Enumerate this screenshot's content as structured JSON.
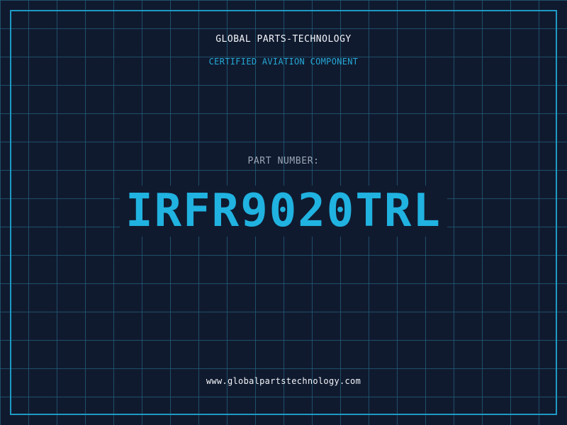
{
  "brand": {
    "name": "GLOBAL PARTS-TECHNOLOGY",
    "tagline": "CERTIFIED AVIATION COMPONENT"
  },
  "part": {
    "label": "PART NUMBER:",
    "number": "IRFR9020TRL"
  },
  "footer": {
    "website": "www.globalpartstechnology.com"
  },
  "colors": {
    "background": "#101a2f",
    "grid": "#225f7a",
    "accent": "#20b2e0",
    "frame": "#1e9ac4",
    "text_primary": "#f2f5f8",
    "text_muted": "#9aa6b6"
  }
}
